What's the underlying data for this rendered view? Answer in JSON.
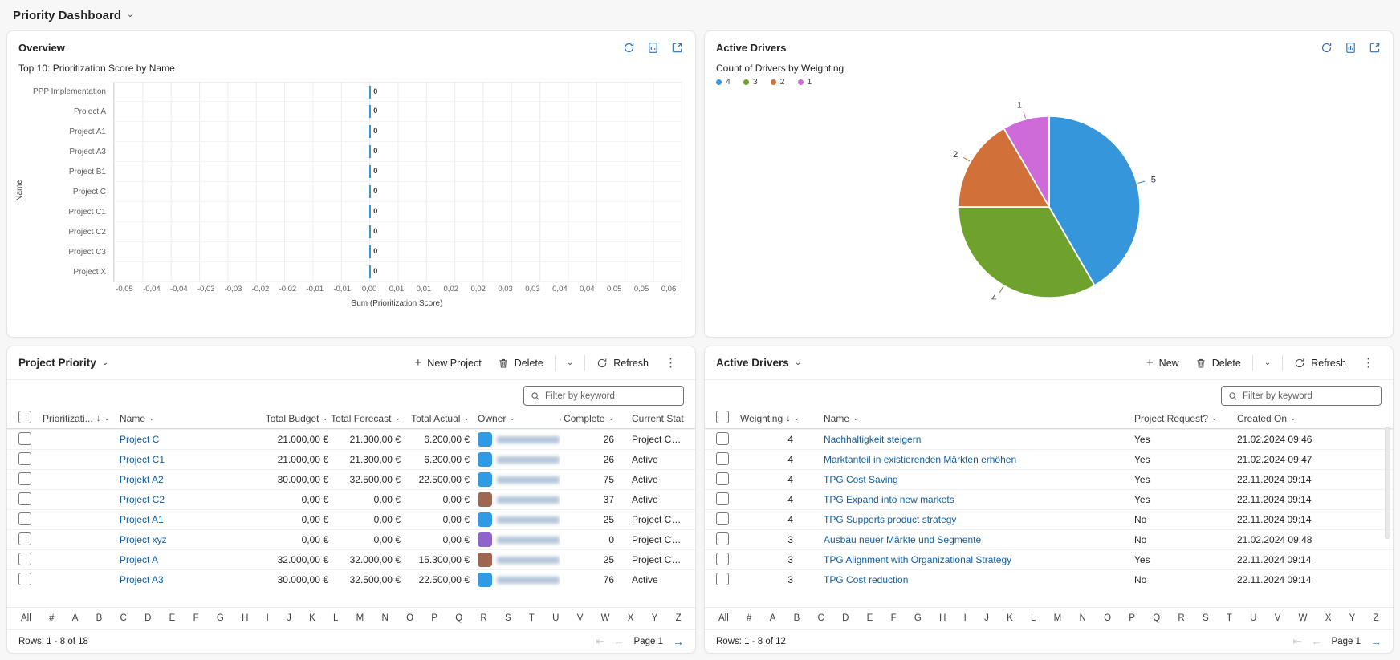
{
  "page_title": "Priority Dashboard",
  "icons": {
    "dropdown_chevron": "⌄",
    "sort_desc": "↓",
    "plus": "+",
    "more_vertical": "⋮",
    "first_page": "⇤",
    "prev_page": "←",
    "next_page": "→"
  },
  "overview": {
    "title": "Overview",
    "chart_data": {
      "type": "bar",
      "orientation": "horizontal",
      "title": "Top 10: Prioritization Score by Name",
      "categories": [
        "PPP Implementation",
        "Project A",
        "Project A1",
        "Project A3",
        "Project B1",
        "Project C",
        "Project C1",
        "Project C2",
        "Project C3",
        "Project X"
      ],
      "values": [
        0,
        0,
        0,
        0,
        0,
        0,
        0,
        0,
        0,
        0
      ],
      "xlabel": "Sum (Prioritization Score)",
      "ylabel": "Name",
      "x_ticks": [
        "-0,05",
        "-0,04",
        "-0,04",
        "-0,03",
        "-0,03",
        "-0,02",
        "-0,02",
        "-0,01",
        "-0,01",
        "0,00",
        "0,01",
        "0,01",
        "0,02",
        "0,02",
        "0,03",
        "0,03",
        "0,04",
        "0,04",
        "0,05",
        "0,05",
        "0,06"
      ],
      "xlim": [
        "-0,05",
        "0,06"
      ],
      "zero_pct": 45,
      "bar_color": "#3596db",
      "grid": true
    }
  },
  "drivers_chart": {
    "title": "Active Drivers",
    "chart_data": {
      "type": "pie",
      "title": "Count of Drivers by Weighting",
      "start_angle_deg": 0,
      "direction": "clockwise",
      "legend_position": "top-left",
      "slices": [
        {
          "weighting": "4",
          "value": 5,
          "color": "#3596db"
        },
        {
          "weighting": "3",
          "value": 4,
          "color": "#6fa22d"
        },
        {
          "weighting": "2",
          "value": 2,
          "color": "#d2703a"
        },
        {
          "weighting": "1",
          "value": 1,
          "color": "#ce6bd8"
        }
      ]
    }
  },
  "project_grid": {
    "title": "Project Priority",
    "toolbar": {
      "new_label": "New Project",
      "delete_label": "Delete",
      "refresh_label": "Refresh"
    },
    "filter_placeholder": "Filter by keyword",
    "columns": [
      "Prioritizati...",
      "Name",
      "Total Budget",
      "Total Forecast",
      "Total Actual",
      "Owner",
      "% Complete",
      "Current State"
    ],
    "sorted_column": "Prioritizati...",
    "sort_direction": "desc",
    "rows": [
      {
        "name": "Project C",
        "budget": "21.000,00 €",
        "forecast": "21.300,00 €",
        "actual": "6.200,00 €",
        "avatar_color": "#2f9be4",
        "complete": "26",
        "state": "Project Crea..."
      },
      {
        "name": "Project C1",
        "budget": "21.000,00 €",
        "forecast": "21.300,00 €",
        "actual": "6.200,00 €",
        "avatar_color": "#2f9be4",
        "complete": "26",
        "state": "Active"
      },
      {
        "name": "Projekt A2",
        "budget": "30.000,00 €",
        "forecast": "32.500,00 €",
        "actual": "22.500,00 €",
        "avatar_color": "#2f9be4",
        "complete": "75",
        "state": "Active"
      },
      {
        "name": "Project C2",
        "budget": "0,00 €",
        "forecast": "0,00 €",
        "actual": "0,00 €",
        "avatar_color": "#9d6752",
        "complete": "37",
        "state": "Active"
      },
      {
        "name": "Project A1",
        "budget": "0,00 €",
        "forecast": "0,00 €",
        "actual": "0,00 €",
        "avatar_color": "#2f9be4",
        "complete": "25",
        "state": "Project Crea..."
      },
      {
        "name": "Project xyz",
        "budget": "0,00 €",
        "forecast": "0,00 €",
        "actual": "0,00 €",
        "avatar_color": "#8f63c9",
        "complete": "0",
        "state": "Project Crea..."
      },
      {
        "name": "Project A",
        "budget": "32.000,00 €",
        "forecast": "32.000,00 €",
        "actual": "15.300,00 €",
        "avatar_color": "#9d6752",
        "complete": "25",
        "state": "Project Crea..."
      },
      {
        "name": "Project A3",
        "budget": "30.000,00 €",
        "forecast": "32.500,00 €",
        "actual": "22.500,00 €",
        "avatar_color": "#2f9be4",
        "complete": "76",
        "state": "Active"
      }
    ],
    "jump_bar": [
      "All",
      "#",
      "A",
      "B",
      "C",
      "D",
      "E",
      "F",
      "G",
      "H",
      "I",
      "J",
      "K",
      "L",
      "M",
      "N",
      "O",
      "P",
      "Q",
      "R",
      "S",
      "T",
      "U",
      "V",
      "W",
      "X",
      "Y",
      "Z"
    ],
    "jump_bar_active": "All",
    "footer": {
      "rows_text": "Rows: 1 - 8 of 18",
      "page_label": "Page 1"
    }
  },
  "drivers_grid": {
    "title": "Active Drivers",
    "toolbar": {
      "new_label": "New",
      "delete_label": "Delete",
      "refresh_label": "Refresh"
    },
    "filter_placeholder": "Filter by keyword",
    "columns": [
      "Weighting",
      "Name",
      "Project Request?",
      "Created On"
    ],
    "sorted_column": "Weighting",
    "sort_direction": "desc",
    "rows": [
      {
        "weighting": "4",
        "name": "Nachhaltigkeit steigern",
        "request": "Yes",
        "created": "21.02.2024 09:46"
      },
      {
        "weighting": "4",
        "name": "Marktanteil in existierenden Märkten erhöhen",
        "request": "Yes",
        "created": "21.02.2024 09:47"
      },
      {
        "weighting": "4",
        "name": "TPG Cost Saving",
        "request": "Yes",
        "created": "22.11.2024 09:14"
      },
      {
        "weighting": "4",
        "name": "TPG Expand into new markets",
        "request": "Yes",
        "created": "22.11.2024 09:14"
      },
      {
        "weighting": "4",
        "name": "TPG Supports product strategy",
        "request": "No",
        "created": "22.11.2024 09:14"
      },
      {
        "weighting": "3",
        "name": "Ausbau neuer Märkte und Segmente",
        "request": "No",
        "created": "21.02.2024 09:48"
      },
      {
        "weighting": "3",
        "name": "TPG Alignment with Organizational Strategy",
        "request": "Yes",
        "created": "22.11.2024 09:14"
      },
      {
        "weighting": "3",
        "name": "TPG Cost reduction",
        "request": "No",
        "created": "22.11.2024 09:14"
      }
    ],
    "jump_bar": [
      "All",
      "#",
      "A",
      "B",
      "C",
      "D",
      "E",
      "F",
      "G",
      "H",
      "I",
      "J",
      "K",
      "L",
      "M",
      "N",
      "O",
      "P",
      "Q",
      "R",
      "S",
      "T",
      "U",
      "V",
      "W",
      "X",
      "Y",
      "Z"
    ],
    "jump_bar_active": "All",
    "footer": {
      "rows_text": "Rows: 1 - 8 of 12",
      "page_label": "Page 1"
    }
  }
}
